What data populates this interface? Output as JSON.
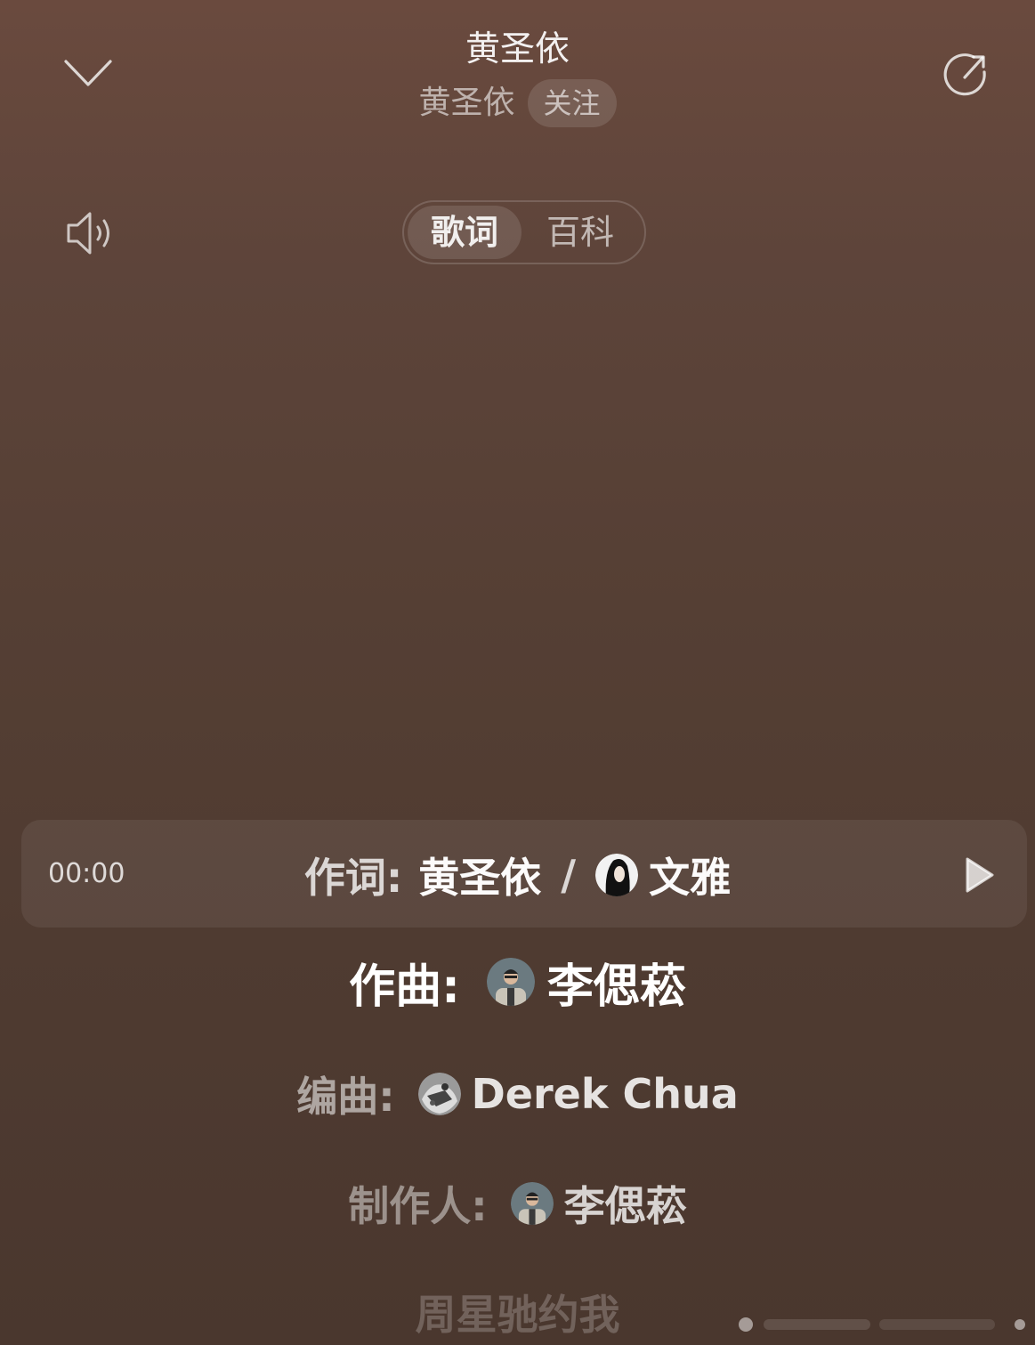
{
  "header": {
    "title": "黄圣依",
    "artist": "黄圣依",
    "follow_label": "关注"
  },
  "tabs": {
    "lyrics_label": "歌词",
    "wiki_label": "百科",
    "active": "歌词"
  },
  "lyrics": {
    "current_time": "00:00",
    "lines": [
      {
        "label": "作词:",
        "name1": "黄圣依",
        "separator": "/",
        "name2": "文雅"
      },
      {
        "label": "作曲:",
        "name": "李偲菘"
      },
      {
        "label": "编曲:",
        "name": "Derek Chua"
      },
      {
        "label": "制作人:",
        "name": "李偲菘"
      },
      {
        "text": "周星驰约我"
      }
    ]
  },
  "icons": {
    "collapse": "chevron-down-icon",
    "share": "share-icon",
    "speaker": "speaker-icon",
    "play": "play-icon"
  },
  "colors": {
    "background_top": "#6a4a3e",
    "background_bottom": "#4a372e"
  }
}
